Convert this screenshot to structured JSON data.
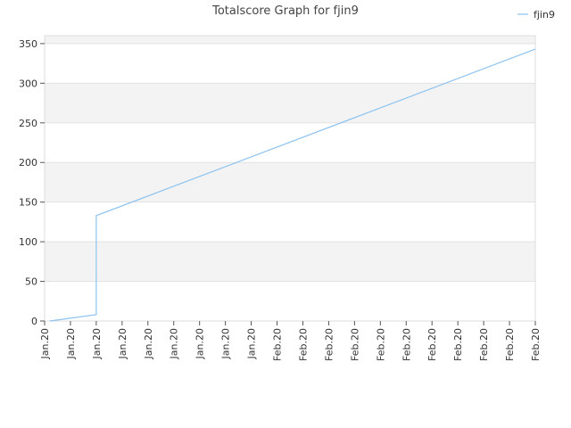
{
  "chart_data": {
    "type": "line",
    "title": "Totalscore Graph for fjin9",
    "xlabel": "",
    "ylabel": "",
    "legend": {
      "position": "top-right"
    },
    "ylim": [
      0,
      360
    ],
    "yticks": [
      0,
      50,
      100,
      150,
      200,
      250,
      300,
      350
    ],
    "xtick_labels": [
      "Jan.20",
      "Jan.20",
      "Jan.20",
      "Jan.20",
      "Jan.20",
      "Jan.20",
      "Jan.20",
      "Jan.20",
      "Jan.20",
      "Feb.20",
      "Feb.20",
      "Feb.20",
      "Feb.20",
      "Feb.20",
      "Feb.20",
      "Feb.20",
      "Feb.20",
      "Feb.20",
      "Feb.20",
      "Feb.20"
    ],
    "grid": "alternating horizontal bands",
    "series": [
      {
        "name": "fjin9",
        "color": "#8dc3f0",
        "points": [
          {
            "x": 0.2,
            "y": 0
          },
          {
            "x": 2.0,
            "y": 8
          },
          {
            "x": 2.0,
            "y": 133
          },
          {
            "x": 19.0,
            "y": 343
          }
        ]
      }
    ]
  }
}
